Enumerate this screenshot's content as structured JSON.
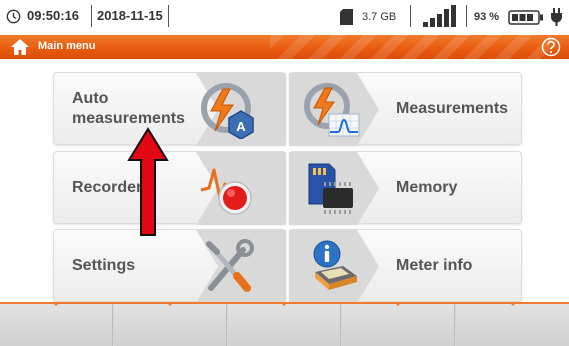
{
  "status_bar": {
    "time": "09:50:16",
    "date": "2018-11-15",
    "storage": "3.7 GB",
    "battery": "93 %",
    "icons": [
      "clock-icon",
      "sd-card-icon",
      "signal-strength-icon",
      "battery-icon",
      "power-plug-icon"
    ]
  },
  "title_bar": {
    "title": "Main menu",
    "icons": [
      "home-icon",
      "help-icon"
    ],
    "accent_color": "#e85a10"
  },
  "menu": {
    "auto_measurements": {
      "line1": "Auto",
      "line2": "measurements",
      "icon": "auto-measurement-icon"
    },
    "measurements": {
      "label": "Measurements",
      "icon": "measurements-icon"
    },
    "recorder": {
      "label": "Recorder",
      "icon": "recorder-icon"
    },
    "memory": {
      "label": "Memory",
      "icon": "memory-card-icon"
    },
    "settings": {
      "label": "Settings",
      "icon": "tools-icon"
    },
    "meter_info": {
      "label": "Meter info",
      "icon": "info-icon"
    }
  },
  "annotation": {
    "type": "red-arrow",
    "points_to": "auto-measurements-button",
    "color": "#e30613"
  },
  "softkeys": {
    "count": 5
  }
}
